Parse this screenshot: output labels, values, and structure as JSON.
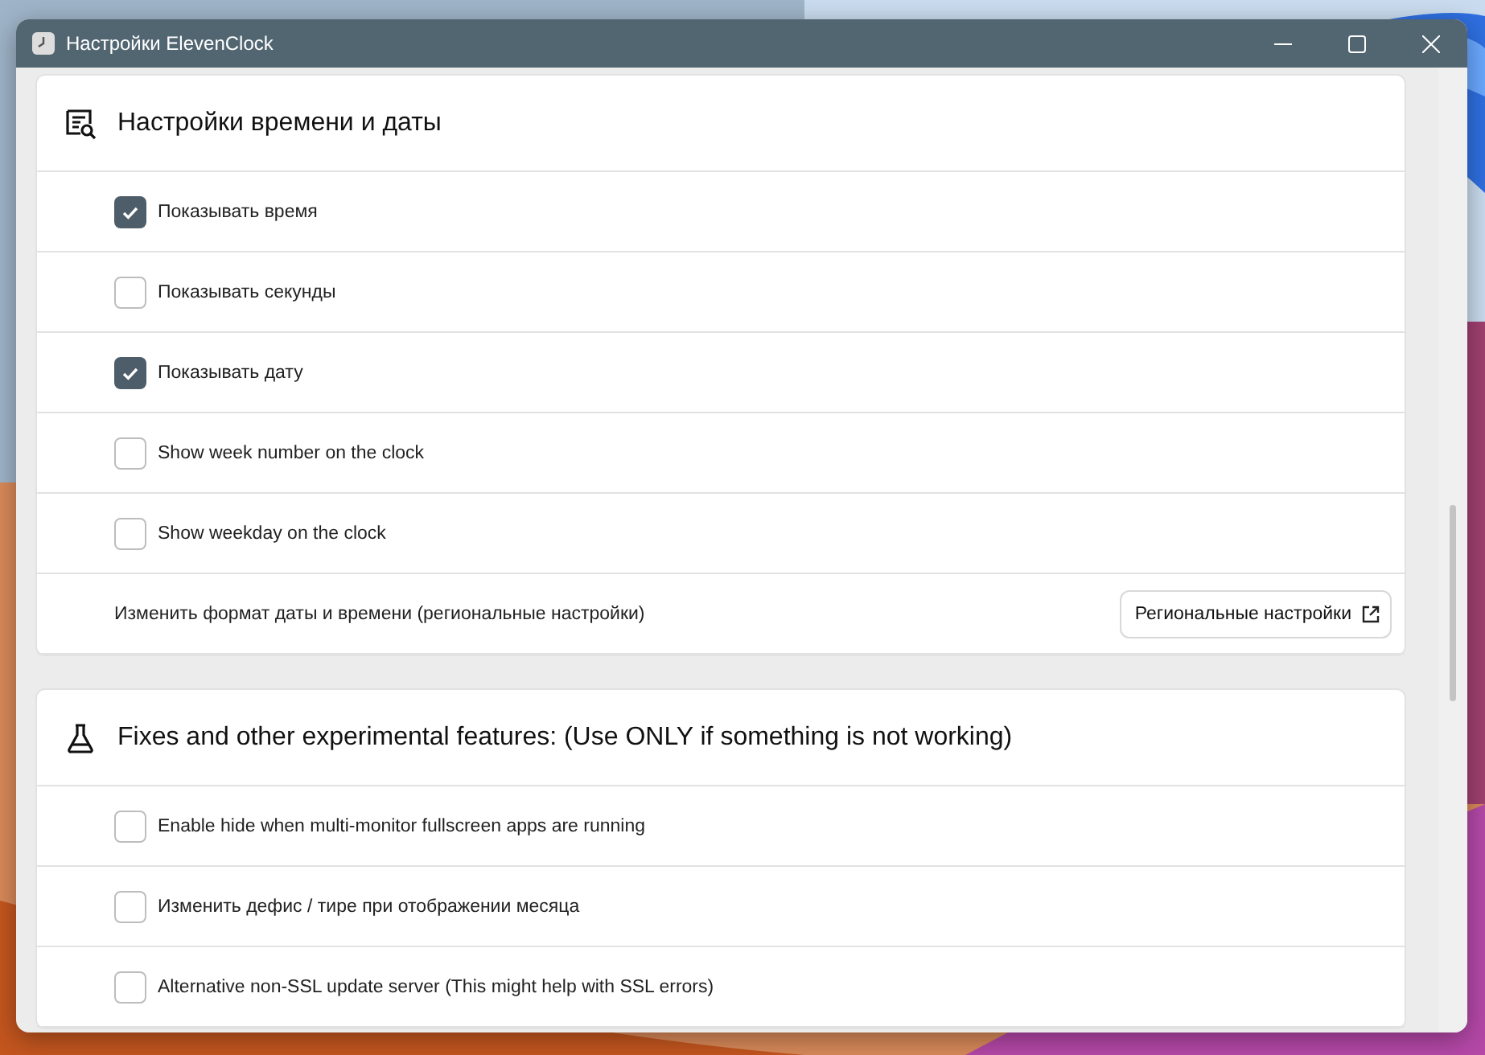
{
  "window": {
    "title": "Настройки ElevenClock"
  },
  "sections": [
    {
      "title": "Настройки времени и даты",
      "items": [
        {
          "kind": "checkbox",
          "label": "Показывать время",
          "checked": true
        },
        {
          "kind": "checkbox",
          "label": "Показывать секунды",
          "checked": false
        },
        {
          "kind": "checkbox",
          "label": "Показывать дату",
          "checked": true
        },
        {
          "kind": "checkbox",
          "label": "Show week number on the clock",
          "checked": false
        },
        {
          "kind": "checkbox",
          "label": "Show weekday on the clock",
          "checked": false
        },
        {
          "kind": "button",
          "label": "Изменить формат даты и времени (региональные настройки)",
          "button": "Региональные настройки"
        }
      ]
    },
    {
      "title": "Fixes and other experimental features: (Use ONLY if something is not working)",
      "items": [
        {
          "kind": "checkbox",
          "label": "Enable hide when multi-monitor fullscreen apps are running",
          "checked": false
        },
        {
          "kind": "checkbox",
          "label": "Изменить дефис / тире при отображении месяца",
          "checked": false
        },
        {
          "kind": "checkbox",
          "label": "Alternative non-SSL update server (This might help with SSL errors)",
          "checked": false
        }
      ]
    }
  ]
}
